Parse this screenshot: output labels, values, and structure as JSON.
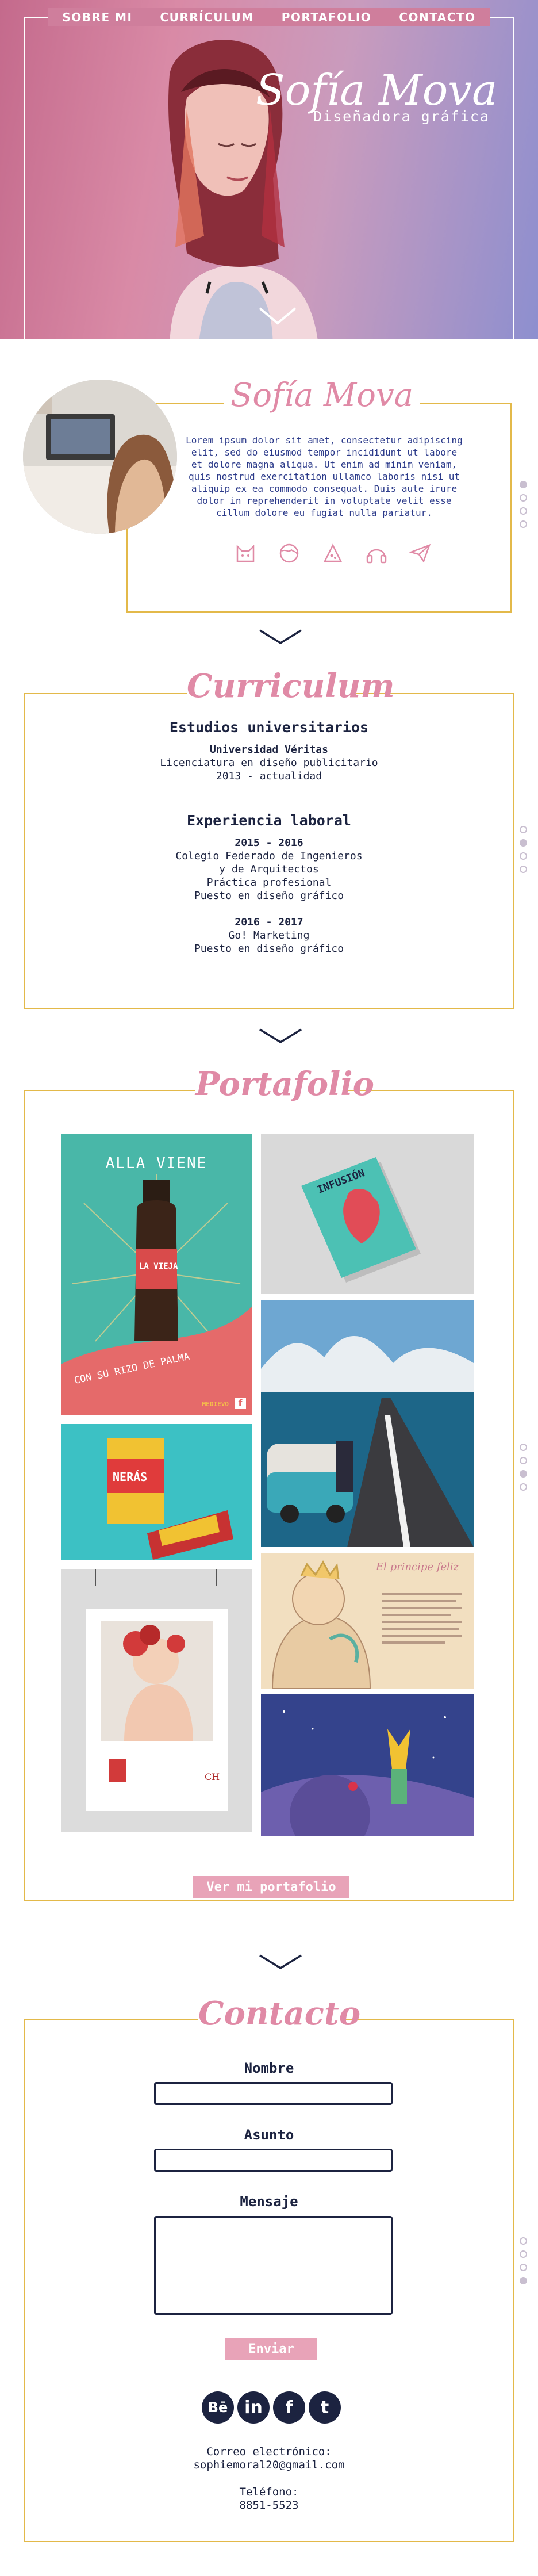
{
  "nav": {
    "items": [
      "SOBRE MI",
      "CURRÍCULUM",
      "PORTAFOLIO",
      "CONTACTO"
    ]
  },
  "hero": {
    "name": "Sofía Mova",
    "subtitle": "Diseñadora gráfica"
  },
  "about": {
    "title": "Sofía Mova",
    "text": "Lorem ipsum dolor sit amet, consectetur adipiscing elit, sed do eiusmod tempor incididunt ut labore et dolore magna aliqua. Ut enim ad minim veniam, quis nostrud exercitation ullamco laboris nisi ut aliquip ex ea commodo consequat. Duis aute irure dolor in reprehenderit in voluptate velit esse cillum dolore eu fugiat nulla pariatur.",
    "icons": [
      "cat-icon",
      "globe-icon",
      "pizza-icon",
      "headphones-icon",
      "paper-plane-icon"
    ]
  },
  "curriculum": {
    "title": "Curriculum",
    "education": {
      "heading": "Estudios universitarios",
      "school": "Universidad Véritas",
      "degree": "Licenciatura en diseño publicitario",
      "years": "2013 - actualidad"
    },
    "experience": {
      "heading": "Experiencia laboral",
      "jobs": [
        {
          "years": "2015 - 2016",
          "lines": [
            "Colegio Federado de Ingenieros",
            "y de Arquitectos",
            "Práctica profesional",
            "Puesto en diseño gráfico"
          ]
        },
        {
          "years": "2016 - 2017",
          "lines": [
            "Go! Marketing",
            "Puesto en diseño gráfico"
          ]
        }
      ]
    }
  },
  "portfolio": {
    "title": "Portafolio",
    "beer": {
      "top": "ALLA VIENE",
      "brand": "LA VIEJA",
      "bottom": "CON SU RIZO DE PALMA",
      "maker": "MEDIEVO"
    },
    "book": "INFUSIÓN",
    "snack": "NERÁS",
    "story_title": "El principe feliz",
    "poster_brand": "CH",
    "button": "Ver mi portafolio"
  },
  "contact": {
    "title": "Contacto",
    "name_label": "Nombre",
    "subject_label": "Asunto",
    "message_label": "Mensaje",
    "send": "Enviar",
    "socials": [
      "Bē",
      "in",
      "f",
      "t"
    ],
    "email_label": "Correo electrónico:",
    "email": "sophiemoral20@gmail.com",
    "phone_label": "Teléfono:",
    "phone": "8851-5523"
  },
  "colors": {
    "accent_pink": "#e08aa6",
    "gold": "#e3b94a",
    "navy": "#1c2340"
  }
}
